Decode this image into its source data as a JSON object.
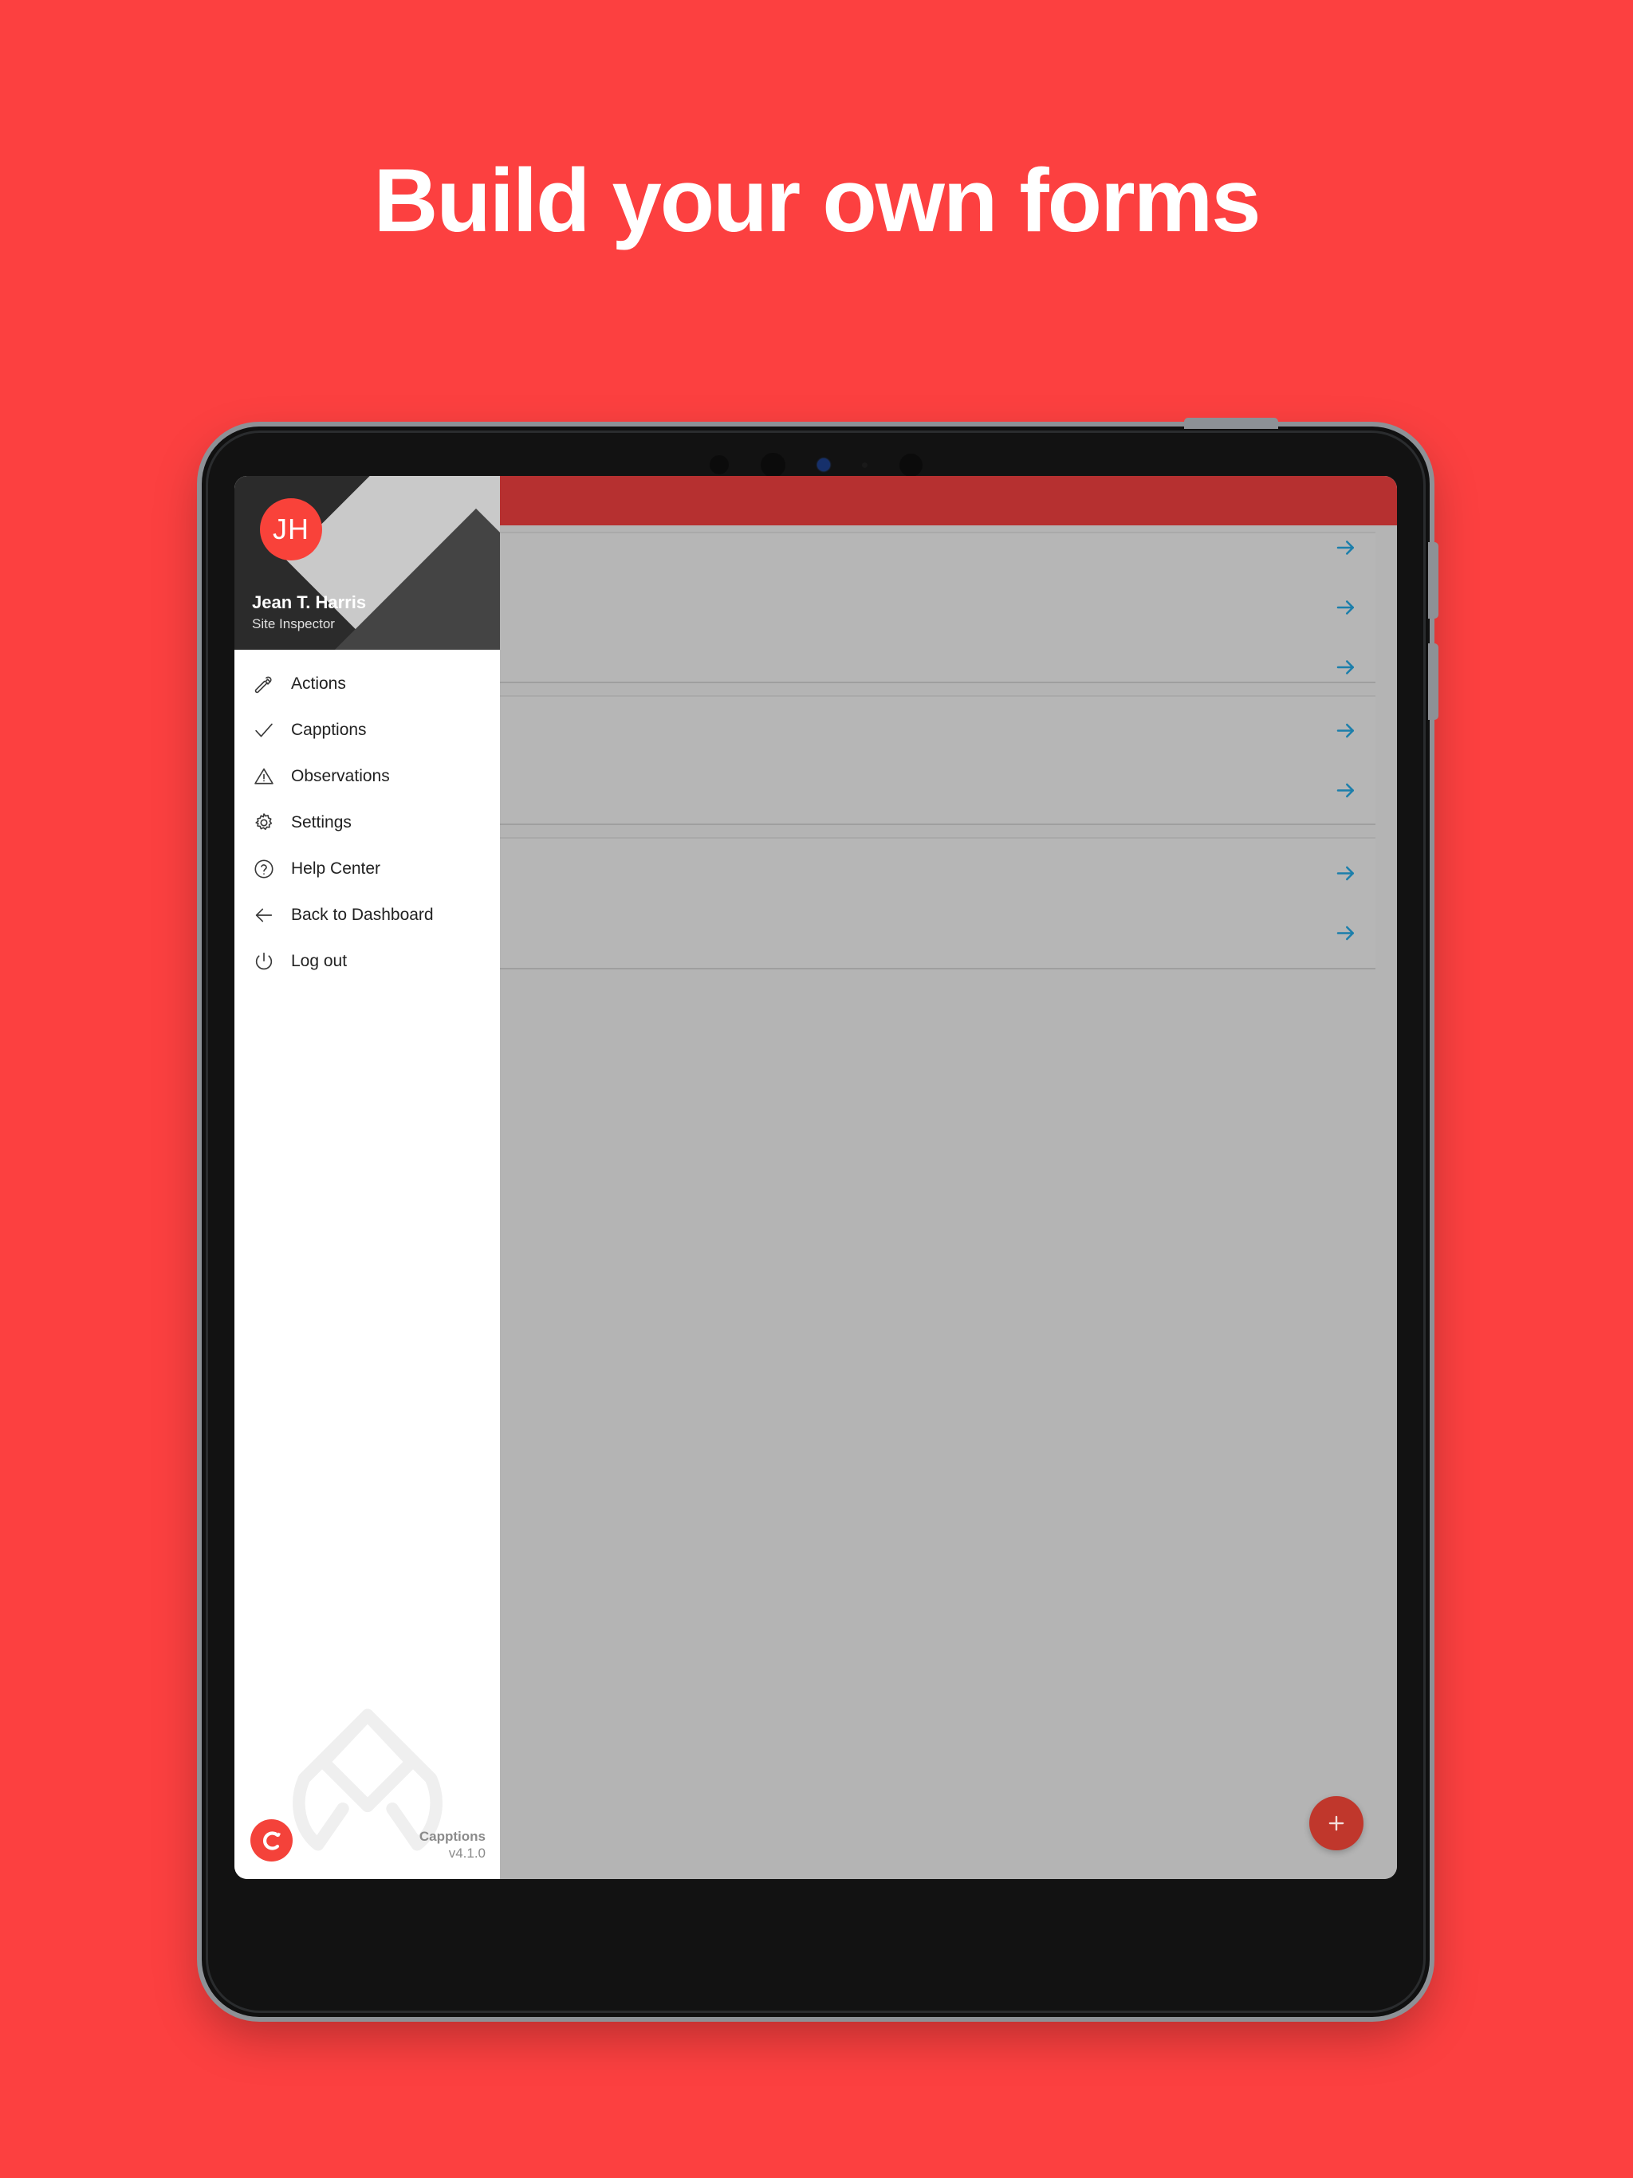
{
  "headline": "Build your own forms",
  "colors": {
    "page_background": "#fc4040",
    "brand_red": "#f4423a",
    "topbar_red": "#b63030",
    "sidebar_dark": "#2b2b2b",
    "accent_blue": "#1c7fab",
    "placeholder_gray": "#b4b4b4"
  },
  "device": {
    "power_button": "power-button",
    "volume_up_button": "volume-up-button",
    "volume_down_button": "volume-down-button",
    "camera": "front-camera"
  },
  "sidebar": {
    "user": {
      "initials": "JH",
      "name": "Jean T. Harris",
      "role": "Site Inspector"
    },
    "items": [
      {
        "label": "Actions",
        "icon": "hammer-icon"
      },
      {
        "label": "Capptions",
        "icon": "check-icon"
      },
      {
        "label": "Observations",
        "icon": "warning-triangle-icon"
      },
      {
        "label": "Settings",
        "icon": "gear-icon"
      },
      {
        "label": "Help Center",
        "icon": "question-circle-icon"
      },
      {
        "label": "Back to Dashboard",
        "icon": "arrow-left-icon"
      },
      {
        "label": "Log out",
        "icon": "power-icon"
      }
    ],
    "footer": {
      "app_name": "Capptions",
      "version": "v4.1.0",
      "logo": "capptions-logo-icon",
      "watermark": "capptions-watermark-icon"
    }
  },
  "content": {
    "topbar": "",
    "cards": [
      {
        "arrow_count": 3
      },
      {
        "arrow_count": 2
      },
      {
        "arrow_count": 2
      }
    ],
    "fab": {
      "icon": "plus-icon",
      "label": "+"
    }
  }
}
